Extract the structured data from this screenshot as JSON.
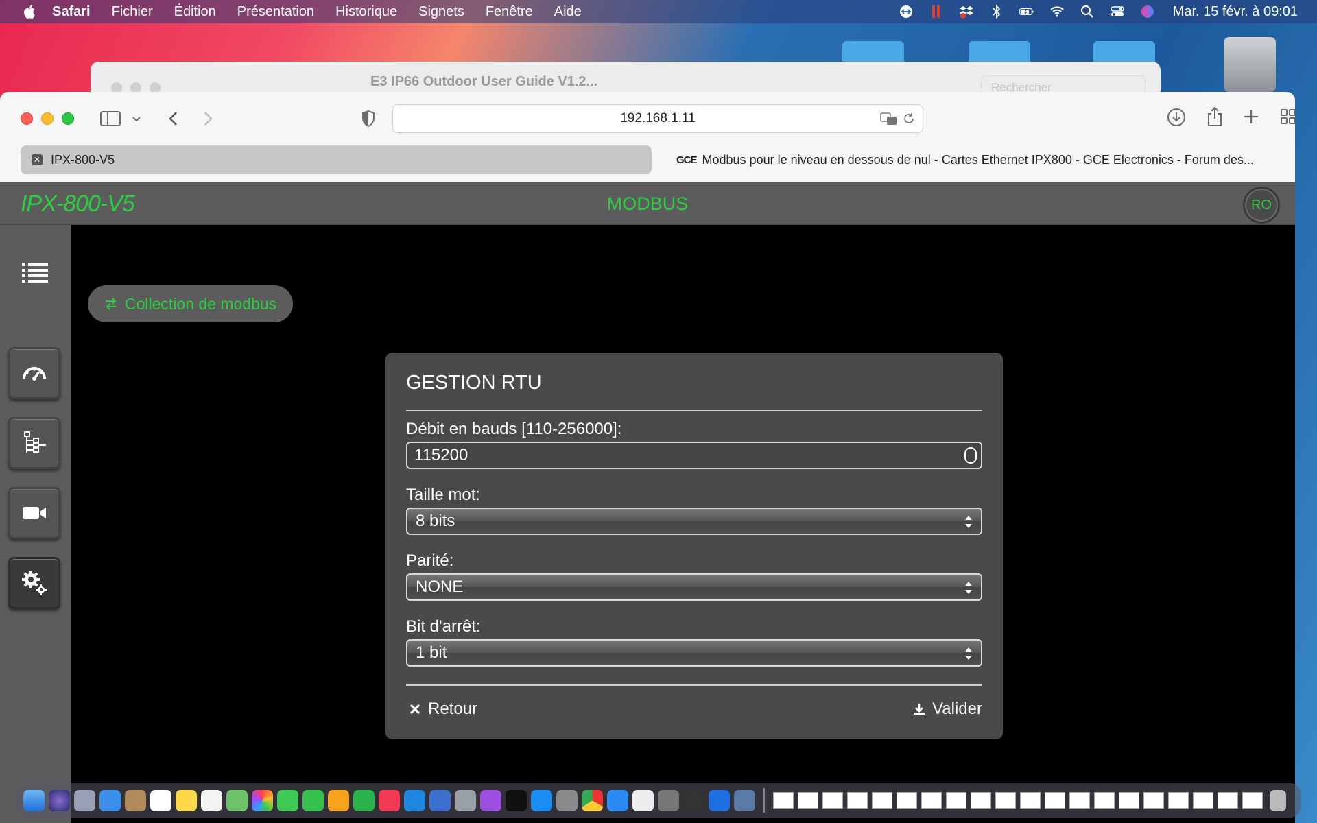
{
  "menubar": {
    "app_name": "Safari",
    "items": [
      "Fichier",
      "Édition",
      "Présentation",
      "Historique",
      "Signets",
      "Fenêtre",
      "Aide"
    ],
    "clock": "Mar. 15 févr. à  09:01",
    "status_icons": [
      "teamviewer-icon",
      "parallels-icon",
      "dropbox-icon",
      "bluetooth-icon",
      "battery-icon",
      "wifi-icon",
      "spotlight-icon",
      "control-center-icon",
      "siri-icon"
    ]
  },
  "background_window": {
    "title": "E3 IP66 Outdoor User Guide V1.2...",
    "search_placeholder": "Rechercher"
  },
  "browser": {
    "url": "192.168.1.11",
    "tabs": [
      {
        "label": "IPX-800-V5",
        "active": true
      },
      {
        "label": "Modbus pour le niveau en dessous de nul - Cartes Ethernet IPX800 - GCE Electronics - Forum des...",
        "favicon": "GCE",
        "active": false
      }
    ]
  },
  "ipx": {
    "logo": "IPX-800-V5",
    "title": "MODBUS",
    "user_badge": "RO",
    "collection_button": "Collection de modbus",
    "colors": {
      "accent": "#2ecc40",
      "panel": "#5c5c5c",
      "dialog": "#4a4a4a"
    }
  },
  "dialog": {
    "title": "GESTION RTU",
    "baud": {
      "label": "Débit en bauds [110-256000]:",
      "value": "115200"
    },
    "word_size": {
      "label": "Taille mot:",
      "value": "8 bits"
    },
    "parity": {
      "label": "Parité:",
      "value": "NONE"
    },
    "stop_bit": {
      "label": "Bit d'arrêt:",
      "value": "1 bit"
    },
    "back_button": "Retour",
    "submit_button": "Valider"
  }
}
